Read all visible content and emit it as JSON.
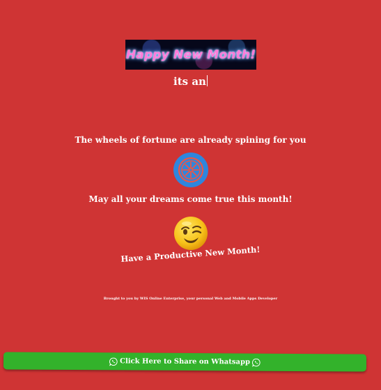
{
  "banner": {
    "text": "Happy New Month!"
  },
  "greeting": {
    "typed_text": "its an"
  },
  "message": {
    "fortune_line": "The wheels of fortune are already spining for you",
    "dreams_line": "May all your dreams come true this month!",
    "productive_line": "Have a Productive New Month!"
  },
  "icons": {
    "wheel": "wheel-icon",
    "emoji": "winking-face-icon",
    "whatsapp": "whatsapp-icon"
  },
  "footer": {
    "credit": "Brought to you by WIS Online Enterprise, your personal Web and Mobile Apps Developer"
  },
  "share_button": {
    "label": "Click Here to Share on Whatsapp"
  },
  "colors": {
    "background": "#cf3434",
    "share_button": "#33b22b",
    "wheel": "#2f86dd",
    "text": "#ffffff"
  }
}
